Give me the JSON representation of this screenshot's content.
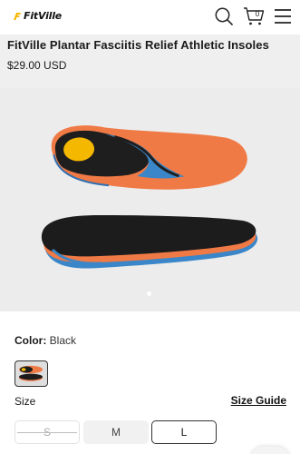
{
  "header": {
    "brand": "FitVille",
    "cart_count": "0",
    "icons": [
      "logo-mark-icon",
      "search-icon",
      "cart-icon",
      "menu-icon"
    ]
  },
  "product": {
    "title": "FitVille Plantar Fasciitis Relief Athletic Insoles",
    "price": "$29.00 USD"
  },
  "gallery": {
    "image": "insole-pair",
    "active_slide": 1,
    "slide_count": 1
  },
  "options": {
    "color_label": "Color:",
    "color_value": "Black",
    "size_label": "Size",
    "size_guide": "Size Guide",
    "sizes": [
      {
        "label": "S",
        "state": "unavailable"
      },
      {
        "label": "M",
        "state": "available"
      },
      {
        "label": "L",
        "state": "selected"
      }
    ]
  },
  "colors": {
    "brand_yellow": "#f5b800",
    "insole_orange": "#f07a45",
    "insole_blue": "#3a86c8",
    "insole_black": "#1c1c1c"
  }
}
